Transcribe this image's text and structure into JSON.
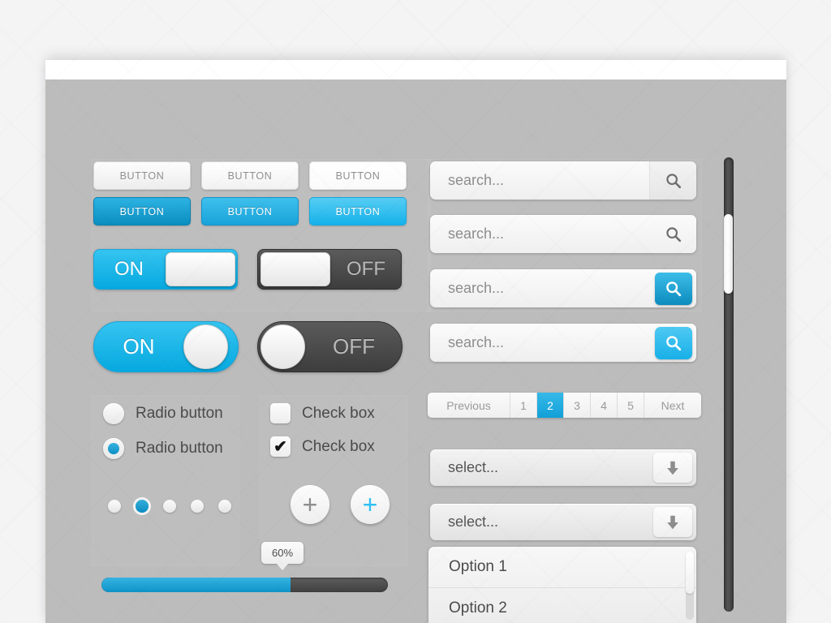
{
  "theme": {
    "accent": "#0fa9e0",
    "panel_bg": "#bcbcbc",
    "page_bg": "#f4f4f5",
    "dark": "#444444",
    "text_gray": "#8e8e8e"
  },
  "buttons": {
    "light_row": [
      {
        "label": "BUTTON"
      },
      {
        "label": "BUTTON"
      },
      {
        "label": "BUTTON"
      }
    ],
    "blue_row": [
      {
        "label": "BUTTON"
      },
      {
        "label": "BUTTON"
      },
      {
        "label": "BUTTON"
      }
    ]
  },
  "toggles": {
    "square_on": {
      "label": "ON",
      "state": "on"
    },
    "square_off": {
      "label": "OFF",
      "state": "off"
    },
    "pill_on": {
      "label": "ON",
      "state": "on"
    },
    "pill_off": {
      "label": "OFF",
      "state": "off"
    }
  },
  "radios": [
    {
      "label": "Radio button",
      "checked": false
    },
    {
      "label": "Radio button",
      "checked": true
    }
  ],
  "checkboxes": [
    {
      "label": "Check box",
      "checked": false,
      "mark": ""
    },
    {
      "label": "Check box",
      "checked": true,
      "mark": "✔"
    }
  ],
  "dots": {
    "count": 5,
    "active_index": 1
  },
  "plus_buttons": [
    {
      "glyph": "+",
      "variant": "gray"
    },
    {
      "glyph": "+",
      "variant": "blue"
    }
  ],
  "progress": {
    "value_label": "60%",
    "percent": 60
  },
  "search_fields": [
    {
      "placeholder": "search...",
      "button": "gray",
      "icon": "search-icon"
    },
    {
      "placeholder": "search...",
      "button": "gray-flat",
      "icon": "search-icon"
    },
    {
      "placeholder": "search...",
      "button": "blue",
      "icon": "search-icon"
    },
    {
      "placeholder": "search...",
      "button": "blue-round",
      "icon": "search-icon"
    }
  ],
  "pagination": {
    "previous_label": "Previous",
    "next_label": "Next",
    "pages": [
      "1",
      "2",
      "3",
      "4",
      "5"
    ],
    "active_page": "2"
  },
  "selects": [
    {
      "placeholder": "select...",
      "icon": "arrow-down-icon"
    },
    {
      "placeholder": "select...",
      "icon": "arrow-down-icon"
    }
  ],
  "dropdown_list": {
    "options": [
      "Option 1",
      "Option 2"
    ]
  },
  "scrollbar": {
    "orientation": "vertical",
    "thumb_position_pct": 22
  }
}
